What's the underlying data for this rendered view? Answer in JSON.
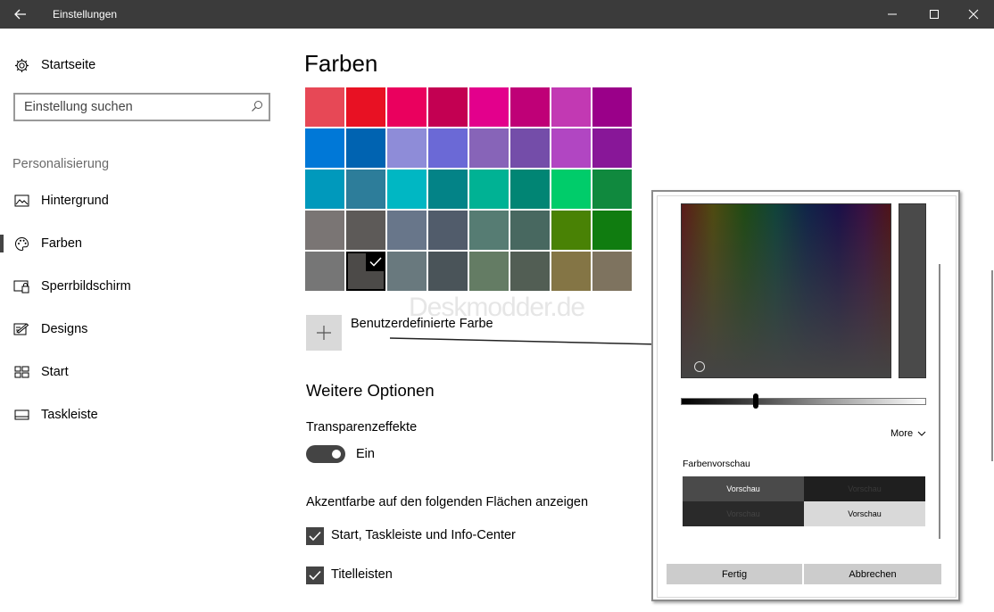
{
  "window": {
    "title": "Einstellungen"
  },
  "sidebar": {
    "home_label": "Startseite",
    "search_placeholder": "Einstellung suchen",
    "section_label": "Personalisierung",
    "items": [
      {
        "label": "Hintergrund",
        "icon": "picture-icon"
      },
      {
        "label": "Farben",
        "icon": "palette-icon",
        "selected": true
      },
      {
        "label": "Sperrbildschirm",
        "icon": "lockscreen-icon"
      },
      {
        "label": "Designs",
        "icon": "designs-icon"
      },
      {
        "label": "Start",
        "icon": "start-icon"
      },
      {
        "label": "Taskleiste",
        "icon": "taskbar-icon"
      }
    ]
  },
  "main": {
    "title": "Farben",
    "swatches": [
      "#e74856",
      "#e81123",
      "#ea005e",
      "#c30052",
      "#e3008c",
      "#bf0077",
      "#c239b3",
      "#9a0089",
      "#0078d7",
      "#0063b1",
      "#8e8cd8",
      "#6b69d6",
      "#8764b8",
      "#744da9",
      "#b146c2",
      "#881798",
      "#0099bc",
      "#2d7d9a",
      "#00b7c3",
      "#038387",
      "#00b294",
      "#018574",
      "#00cc6a",
      "#10893e",
      "#7a7574",
      "#5d5a58",
      "#68768a",
      "#515c6b",
      "#567c73",
      "#486860",
      "#498205",
      "#107c10",
      "#767676",
      "#4c4a48",
      "#69797e",
      "#4a5459",
      "#647c64",
      "#525e54",
      "#847545",
      "#7e735f"
    ],
    "selected_swatch_index": 33,
    "custom_color_label": "Benutzerdefinierte Farbe",
    "watermark": "Deskmodder.de",
    "more_options_heading": "Weitere Optionen",
    "transparency_label": "Transparenzeffekte",
    "transparency_state": "Ein",
    "accent_heading": "Akzentfarbe auf den folgenden Flächen anzeigen",
    "checkboxes": [
      {
        "label": "Start, Taskleiste und Info-Center",
        "checked": true
      },
      {
        "label": "Titelleisten",
        "checked": true
      }
    ]
  },
  "dialog": {
    "more_label": "More",
    "preview_title": "Farbenvorschau",
    "preview_cells": [
      {
        "label": "Vorschau",
        "bg": "#4a4a4a",
        "fg": "#ffffff"
      },
      {
        "label": "Vorschau",
        "bg": "#1f1f1f",
        "fg": "#3a3a3a"
      },
      {
        "label": "Vorschau",
        "bg": "#2a2a2a",
        "fg": "#444444"
      },
      {
        "label": "Vorschau",
        "bg": "#d9d9d9",
        "fg": "#000000"
      }
    ],
    "done_label": "Fertig",
    "cancel_label": "Abbrechen"
  },
  "colors": {
    "titlebar": "#3b3b3b",
    "accent": "#4c4a48"
  }
}
